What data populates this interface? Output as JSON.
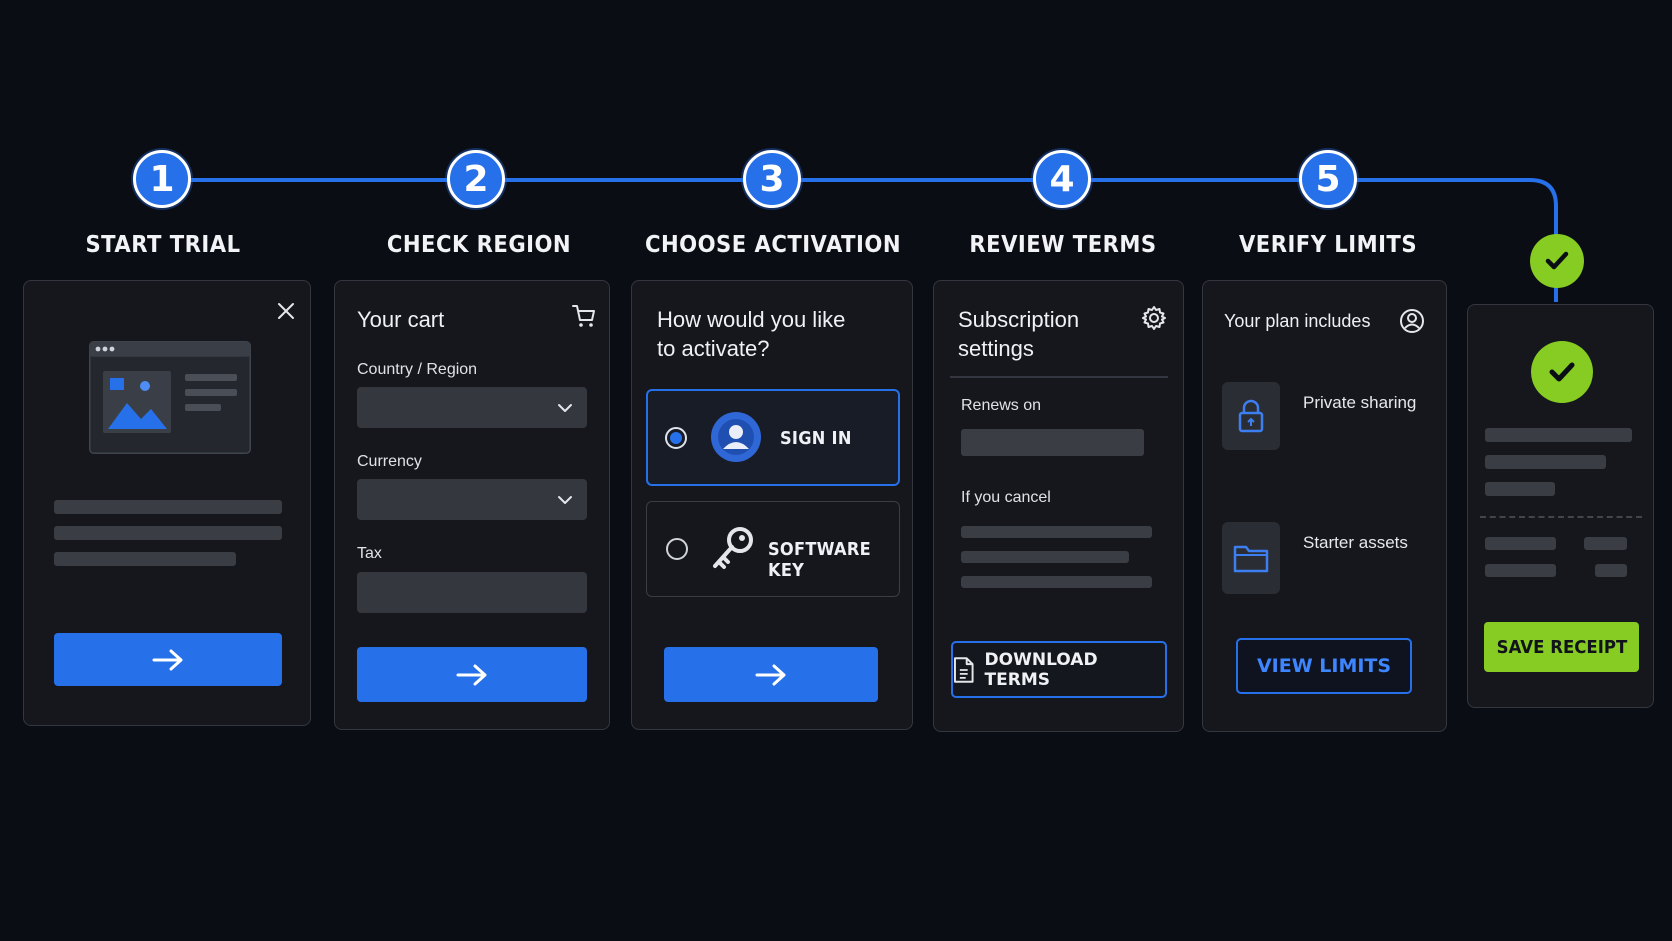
{
  "colors": {
    "background": "#0b0d14",
    "accent_blue": "#2670ea",
    "success_green": "#86cc23",
    "card_bg": "#15171d",
    "placeholder": "#3a3d44"
  },
  "steps": [
    {
      "number": "1",
      "title": "START TRIAL"
    },
    {
      "number": "2",
      "title": "CHECK REGION"
    },
    {
      "number": "3",
      "title": "CHOOSE ACTIVATION"
    },
    {
      "number": "4",
      "title": "REVIEW TERMS"
    },
    {
      "number": "5",
      "title": "VERIFY LIMITS"
    }
  ],
  "card_start": {
    "close_icon": "close-icon",
    "illustration": "browser-window-image-icon",
    "next_icon": "arrow-right-icon"
  },
  "card_region": {
    "title": "Your cart",
    "cart_icon": "shopping-cart-icon",
    "country_label": "Country / Region",
    "country_value": "",
    "currency_label": "Currency",
    "currency_value": "",
    "tax_label": "Tax",
    "tax_value": "",
    "next_icon": "arrow-right-icon"
  },
  "card_activation": {
    "question": "How would you like to activate?",
    "options": [
      {
        "label": "SIGN IN",
        "selected": true,
        "icon": "user-icon"
      },
      {
        "label": "SOFTWARE KEY",
        "selected": false,
        "icon": "key-icon"
      }
    ],
    "next_icon": "arrow-right-icon"
  },
  "card_terms": {
    "title": "Subscription settings",
    "settings_icon": "gear-icon",
    "renews_label": "Renews on",
    "cancel_label": "If you cancel",
    "download_label": "DOWNLOAD TERMS",
    "download_icon": "document-icon"
  },
  "card_limits": {
    "title": "Your plan includes",
    "account_icon": "user-circle-icon",
    "features": [
      {
        "label": "Private sharing",
        "icon": "lock-icon"
      },
      {
        "label": "Starter assets",
        "icon": "folder-icon"
      }
    ],
    "view_label": "VIEW LIMITS"
  },
  "card_receipt": {
    "status_icon": "check-circle-icon",
    "save_label": "SAVE RECEIPT"
  }
}
